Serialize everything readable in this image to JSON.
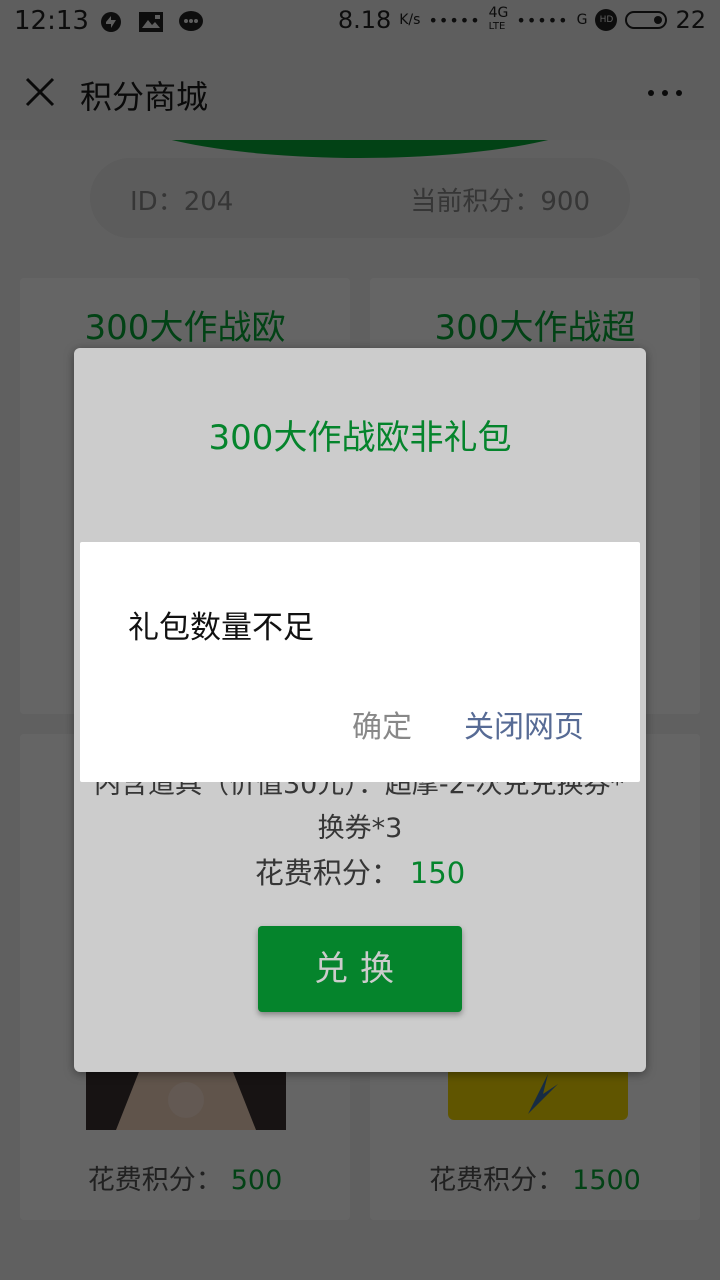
{
  "status_bar": {
    "time": "12:13",
    "speed": "8.18",
    "speed_unit": "K/s",
    "network": "4G",
    "network_sub": "LTE",
    "carrier_g": "G",
    "hd": "HD",
    "battery": "22",
    "icons_left": [
      "sync-icon",
      "image-icon",
      "wechat-icon"
    ]
  },
  "nav": {
    "title": "积分商城"
  },
  "user": {
    "id_text": "ID：204",
    "points_text": "当前积分：900"
  },
  "cards": [
    {
      "title": "300大作战欧",
      "cost_label": "花费积分：",
      "cost_value": "500"
    },
    {
      "title": "300大作战超",
      "cost_label": "花费积分：",
      "cost_value": "1500"
    }
  ],
  "modal": {
    "title": "300大作战欧非礼包",
    "description": "内含道具（价值30元）：超摩-2-次兑兑换券*3",
    "description_line2": "换券*3",
    "cost_label": "花费积分：",
    "cost_value": "150",
    "exchange_label": "兑换"
  },
  "alert": {
    "message": "礼包数量不足",
    "ok_label": "确定",
    "close_label": "关闭网页"
  },
  "colors": {
    "accent_green": "#07a637",
    "link_blue": "#576b95"
  }
}
